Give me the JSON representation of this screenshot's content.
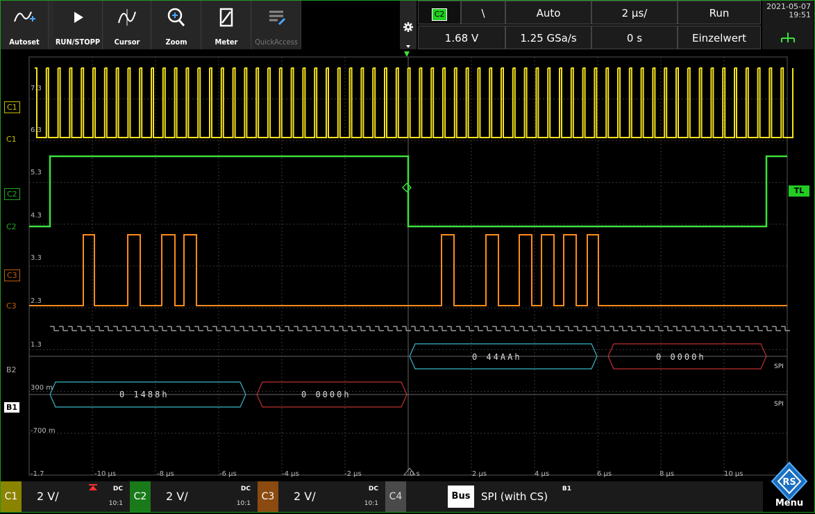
{
  "toolbar": {
    "autoset": "Autoset",
    "run_stop": "RUN/STOPP",
    "cursor": "Cursor",
    "zoom": "Zoom",
    "meter": "Meter",
    "quickaccess": "QuickAccess"
  },
  "trigger": {
    "source": "C2",
    "edge_symbol": "\\",
    "mode": "Auto",
    "timebase": "2 µs/",
    "state": "Run",
    "level": "1.68 V",
    "sample_rate": "1.25 GSa/s",
    "position": "0 s",
    "acq_mode": "Einzelwert"
  },
  "datetime": {
    "date": "2021-05-07",
    "time": "19:51"
  },
  "markers": {
    "c1_thr": "C1",
    "c1": "C1",
    "c2_thr": "C2",
    "c2": "C2",
    "c3_thr": "C3",
    "c3": "C3",
    "b2": "B2",
    "b1": "B1",
    "tl": "TL"
  },
  "y_labels": [
    "7.3",
    "6.3",
    "5.3",
    "4.3",
    "3.3",
    "2.3",
    "1.3",
    "300 m",
    "-700 m",
    "-1.7"
  ],
  "x_labels": [
    "-10 µs",
    "-8 µs",
    "-6 µs",
    "-4 µs",
    "-2 µs",
    "0 s",
    "2 µs",
    "4 µs",
    "6 µs",
    "8 µs",
    "10 µs"
  ],
  "bus": {
    "b2_words": [
      "0  44AAh",
      "0  0000h"
    ],
    "b1_words": [
      "0  1488h",
      "0  0000h"
    ],
    "b2_label": "SPI",
    "b1_label": "SPI"
  },
  "channels": [
    {
      "tag": "C1",
      "scale": "2 V/",
      "coupling": "DC",
      "ratio": "10:1",
      "color": "#c8c000"
    },
    {
      "tag": "C2",
      "scale": "2 V/",
      "coupling": "DC",
      "ratio": "10:1",
      "color": "#22aa22"
    },
    {
      "tag": "C3",
      "scale": "2 V/",
      "coupling": "DC",
      "ratio": "10:1",
      "color": "#c06010"
    },
    {
      "tag": "C4",
      "color": "#888888"
    }
  ],
  "bus_panel": {
    "tag": "Bus",
    "name": "SPI (with CS)",
    "bus_id": "B1"
  },
  "menu_label": "Menu",
  "colors": {
    "c1": "#f5e21a",
    "c2": "#3de03d",
    "c3": "#ff8c1a",
    "b1": "#3ab8c8",
    "b2_red": "#c03030",
    "grid": "#3a3a3a",
    "frame": "#1e9a1e"
  }
}
